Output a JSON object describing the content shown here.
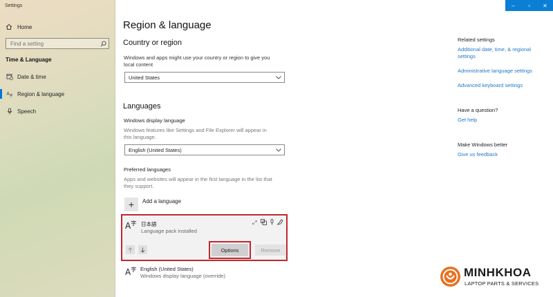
{
  "window": {
    "app_title": "Settings",
    "controls": {
      "minimize": "–",
      "maximize": "▫",
      "close": "✕"
    }
  },
  "sidebar": {
    "home_label": "Home",
    "search_placeholder": "Find a setting",
    "section_heading": "Time & Language",
    "items": [
      {
        "label": "Date & time",
        "icon": "calendar-clock-icon",
        "active": false
      },
      {
        "label": "Region & language",
        "icon": "globe-icon",
        "active": true
      },
      {
        "label": "Speech",
        "icon": "microphone-icon",
        "active": false
      }
    ]
  },
  "main": {
    "page_title": "Region & language",
    "country": {
      "heading": "Country or region",
      "description": "Windows and apps might use your country or region to give you local content",
      "selected": "United States"
    },
    "languages": {
      "heading": "Languages",
      "display_label": "Windows display language",
      "display_description": "Windows features like Settings and File Explorer will appear in this language.",
      "display_selected": "English (United States)",
      "preferred_label": "Preferred languages",
      "preferred_description": "Apps and websites will appear in the first language in the list that they support.",
      "add_label": "Add a language",
      "list": [
        {
          "name": "日本語",
          "status": "Language pack installed",
          "selected": true
        },
        {
          "name": "English (United States)",
          "status": "Windows display language (override)",
          "selected": false
        }
      ],
      "options_label": "Options",
      "remove_label": "Remove"
    }
  },
  "related": {
    "heading": "Related settings",
    "links": [
      "Additional date, time, & regional settings",
      "Administrative language settings",
      "Advanced keyboard settings"
    ],
    "question_heading": "Have a question?",
    "question_link": "Get help",
    "better_heading": "Make Windows better",
    "better_link": "Give us feedback"
  },
  "watermark": {
    "name": "MINHKHOA",
    "tagline": "LAPTOP PARTS & SERVICES"
  },
  "colors": {
    "accent": "#0078d7",
    "highlight_box": "#c0272d",
    "link": "#1f78c8",
    "brand_orange": "#e8701f"
  }
}
